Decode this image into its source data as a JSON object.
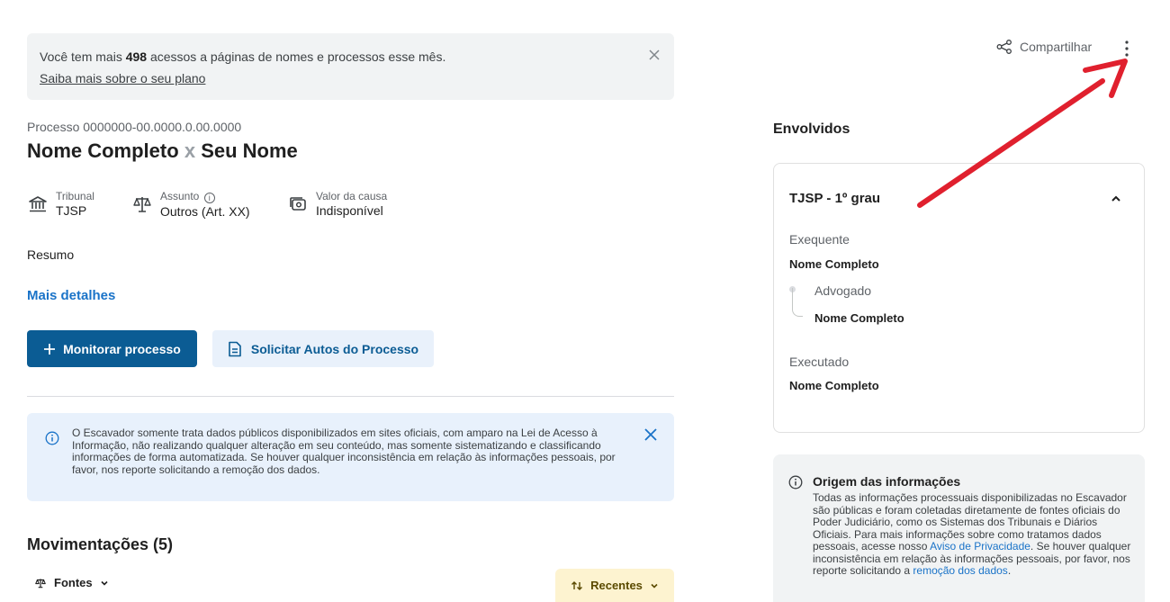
{
  "quota_banner": {
    "text_before": "Você tem mais ",
    "count": "498",
    "text_after": " acessos a páginas de nomes e processos esse mês.",
    "link": "Saiba mais sobre o seu plano"
  },
  "process": {
    "number": "Processo 0000000-00.0000.0.00.0000",
    "party_a": "Nome Completo",
    "separator": "x",
    "party_b": "Seu Nome"
  },
  "meta": {
    "tribunal_label": "Tribunal",
    "tribunal_value": "TJSP",
    "assunto_label": "Assunto",
    "assunto_value": "Outros (Art. XX)",
    "valor_label": "Valor da causa",
    "valor_value": "Indisponível"
  },
  "resumo": "Resumo",
  "mais_detalhes": "Mais detalhes",
  "actions": {
    "monitor": "Monitorar processo",
    "autos": "Solicitar Autos do Processo"
  },
  "notice": "O Escavador somente trata dados públicos disponibilizados em sites oficiais, com amparo na Lei de Acesso à Informação, não realizando qualquer alteração em seu conteúdo, mas somente sistematizando e classificando informações de forma automatizada. Se houver qualquer inconsistência em relação às informações pessoais, por favor, nos reporte solicitando a remoção dos dados.",
  "movimentacoes": {
    "title": "Movimentações (5)",
    "fontes": "Fontes",
    "sort": "Recentes"
  },
  "header": {
    "share": "Compartilhar"
  },
  "envolvidos": {
    "title": "Envolvidos",
    "court": "TJSP - 1º grau",
    "exequente_label": "Exequente",
    "exequente_name": "Nome Completo",
    "advogado_label": "Advogado",
    "advogado_name": "Nome Completo",
    "executado_label": "Executado",
    "executado_name": "Nome Completo"
  },
  "origem": {
    "title": "Origem das informações",
    "text_1": "Todas as informações processuais disponibilizadas no Escavador são públicas e foram coletadas diretamente de fontes oficiais do Poder Judiciário, como os Sistemas dos Tribunais e Diários Oficiais. Para mais informações sobre como tratamos dados pessoais, acesse nosso ",
    "link_1": "Aviso de Privacidade",
    "text_2": ". Se houver qualquer inconsistência em relação às informações pessoais, por favor, nos reporte solicitando a ",
    "link_2": "remoção dos dados",
    "text_3": "."
  },
  "colors": {
    "primary": "#0b5c94",
    "link": "#1a73c8",
    "annotation_arrow": "#e0202e"
  }
}
